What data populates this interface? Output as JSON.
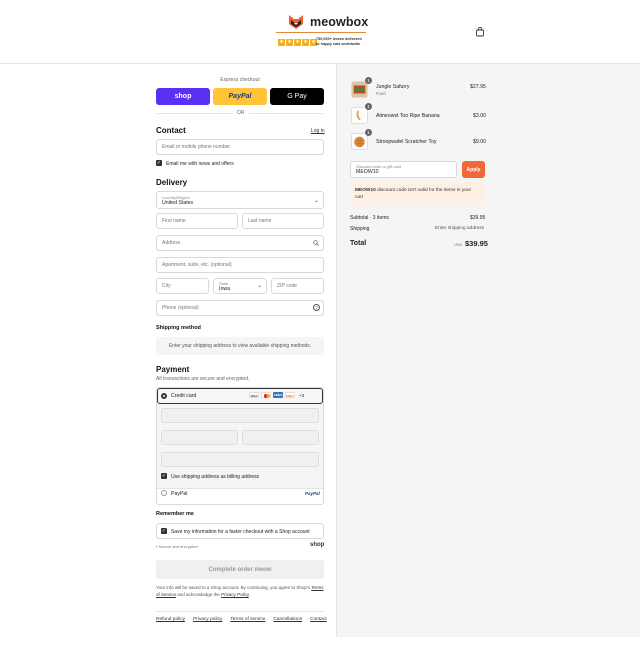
{
  "brand": {
    "name": "meowbox",
    "tagline": "750,000+ boxes delivered to happy cats worldwide"
  },
  "express": {
    "title": "Express checkout",
    "shop_label": "shop",
    "paypal_label": "PayPal",
    "gpay_label": "G Pay",
    "or": "OR"
  },
  "contact": {
    "title": "Contact",
    "login": "Log in",
    "email_placeholder": "Email or mobile phone number",
    "news_label": "Email me with news and offers"
  },
  "delivery": {
    "title": "Delivery",
    "country_label": "Country/Region",
    "country_value": "United States",
    "first_name": "First name",
    "last_name": "Last name",
    "address": "Address",
    "apartment": "Apartment, suite, etc. (optional)",
    "city": "City",
    "state_label": "State",
    "state_value": "Iowa",
    "zip": "ZIP code",
    "phone": "Phone (optional)"
  },
  "shipping": {
    "title": "Shipping method",
    "note": "Enter your shipping address to view available shipping methods."
  },
  "payment": {
    "title": "Payment",
    "subtitle": "All transactions are secure and encrypted.",
    "credit_card": "Credit card",
    "more_cards": "+3",
    "billing_label": "Use shipping address as billing address",
    "paypal": "PayPal",
    "paypal_logo": "PayPal"
  },
  "remember": {
    "title": "Remember me",
    "label": "Save my information for a faster checkout with a Shop account",
    "secure": "Secure and encrypted",
    "shop": "shop"
  },
  "complete": {
    "label": "Complete order meow"
  },
  "legal": {
    "line1": "Your info will be saved to a Shop account. By continuing, you agree to Shop's",
    "terms": "Terms of Service",
    "and": "and acknowledge the",
    "privacy": "Privacy Policy",
    "end": "."
  },
  "footer": {
    "links": [
      "Refund policy",
      "Privacy policy",
      "Terms of service",
      "Cancellations",
      "Contact"
    ]
  },
  "summary": {
    "items": [
      {
        "qty": "1",
        "name": "Jungle Safurry",
        "sub": "Food",
        "price": "$27.95"
      },
      {
        "qty": "1",
        "name": "Almeowst Too Ripe Banana",
        "sub": "",
        "price": "$3.00"
      },
      {
        "qty": "1",
        "name": "Stroopwafel Scratcher Toy",
        "sub": "",
        "price": "$9.00"
      }
    ],
    "discount_label": "Discount code or gift card",
    "discount_value": "MEOW10",
    "apply": "Apply",
    "error_code": "MEOW10",
    "error_text": "discount code isn't valid for the items in your cart",
    "subtotal_label": "Subtotal · 3 items",
    "subtotal": "$39.95",
    "shipping_label": "Shipping",
    "shipping_value": "Enter shipping address",
    "total_label": "Total",
    "currency": "USD",
    "total": "$39.95"
  },
  "colors": {
    "accent": "#f0683a",
    "shop": "#5a31f4",
    "paypal": "#ffc439",
    "gpay": "#000000"
  }
}
